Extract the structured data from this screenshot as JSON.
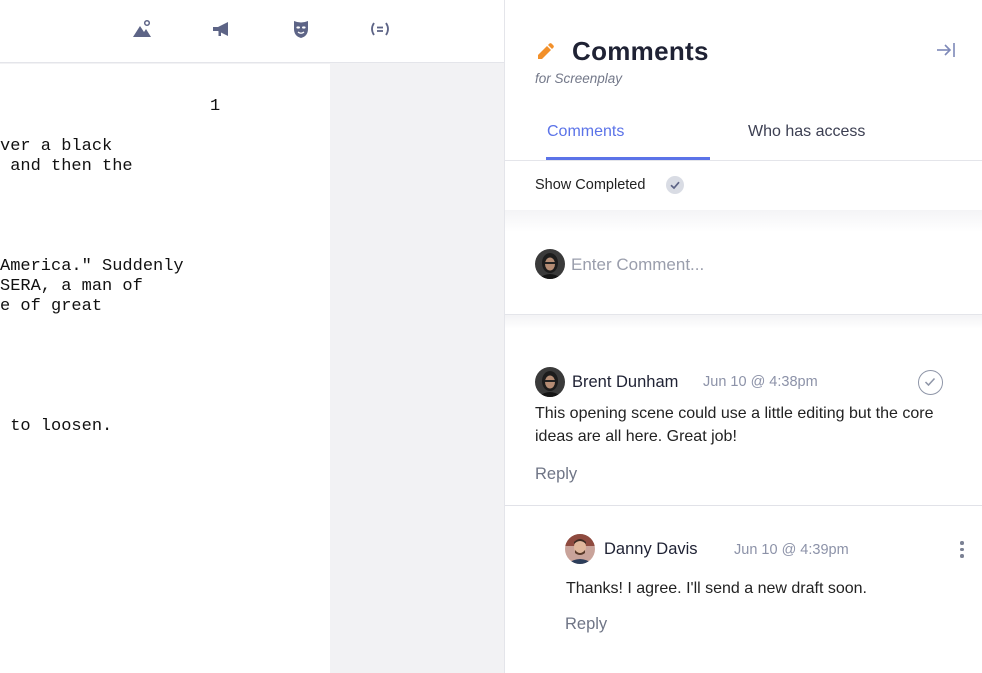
{
  "toolbar": {
    "icons": [
      "scene-image-icon",
      "megaphone-icon",
      "mask-icon",
      "formula-icon"
    ]
  },
  "script": {
    "page_number": "1",
    "lines": [
      "ver a black",
      " and then the",
      "America.\" Suddenly",
      "SERA, a man of",
      "e of great",
      " to loosen."
    ]
  },
  "panel": {
    "title": "Comments",
    "subtitle": "for Screenplay",
    "tabs": [
      {
        "label": "Comments",
        "active": true
      },
      {
        "label": "Who has access",
        "active": false
      }
    ],
    "show_completed_label": "Show Completed",
    "comment_input_placeholder": "Enter Comment...",
    "accent_color": "#5b73e8",
    "pencil_color": "#f2902a"
  },
  "comments": [
    {
      "author": "Brent Dunham",
      "time": "Jun 10 @ 4:38pm",
      "body": "This opening scene could use a little editing but the core ideas are all here. Great job!",
      "reply_label": "Reply"
    },
    {
      "author": "Danny Davis",
      "time": "Jun 10 @ 4:39pm",
      "body": "Thanks! I agree. I'll send a new draft soon.",
      "reply_label": "Reply"
    }
  ]
}
